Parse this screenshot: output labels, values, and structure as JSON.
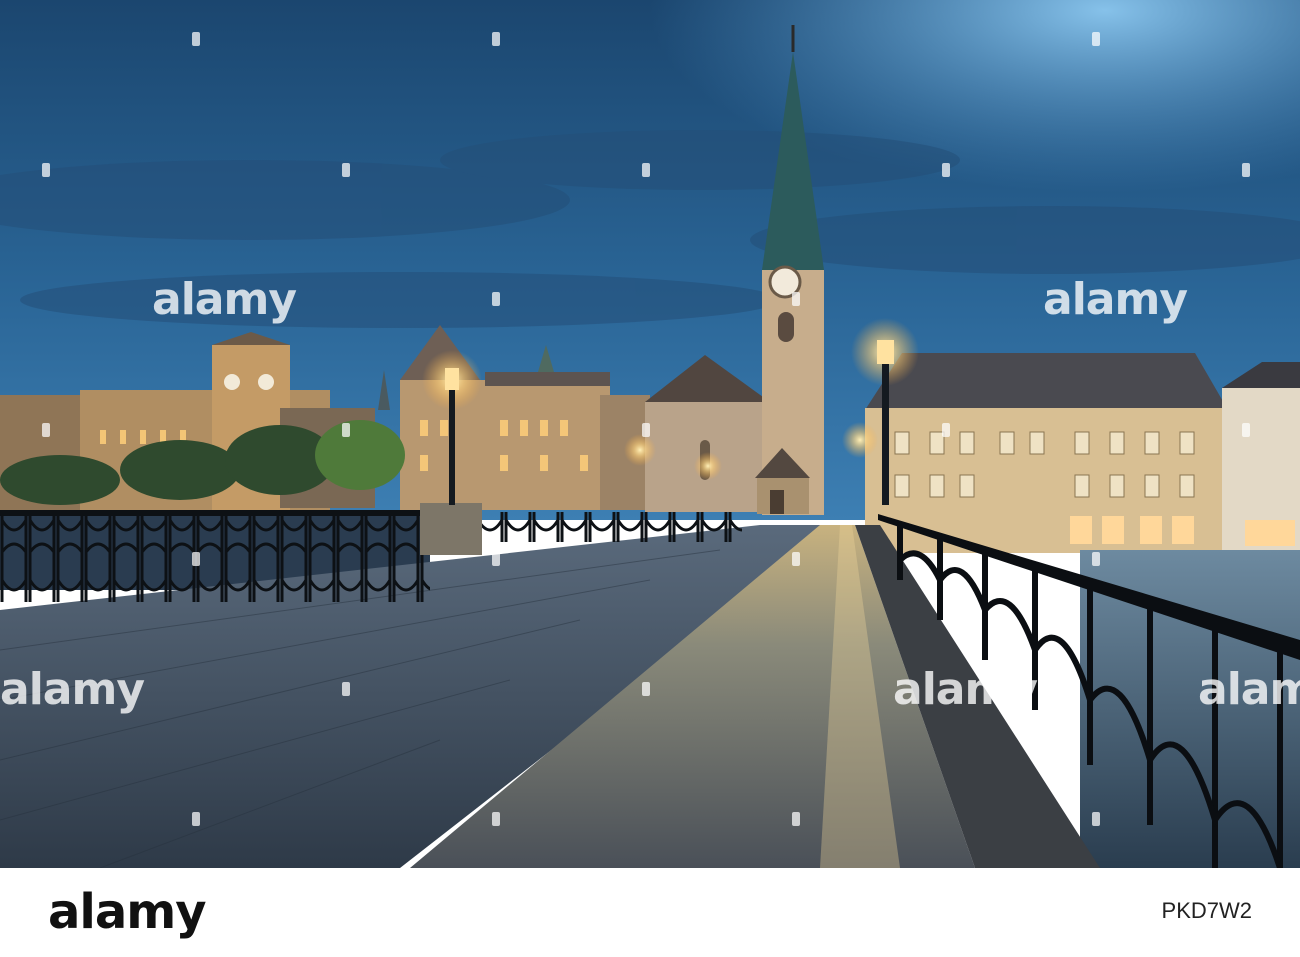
{
  "image": {
    "description_tag": "night-cityscape-photo",
    "colors": {
      "sky_top": "#1d4c78",
      "sky_mid": "#2f73a8",
      "sky_glow": "#6fb5e6",
      "building_lit": "#c9a06a",
      "bridge_railing": "#101418",
      "cobbles": "#3d4b5c",
      "lamp_light": "#ffd98a"
    }
  },
  "watermark": {
    "text": "alamy"
  },
  "footer": {
    "logo": "alamy",
    "image_id": "PKD7W2",
    "credit": "",
    "tagline": ""
  }
}
